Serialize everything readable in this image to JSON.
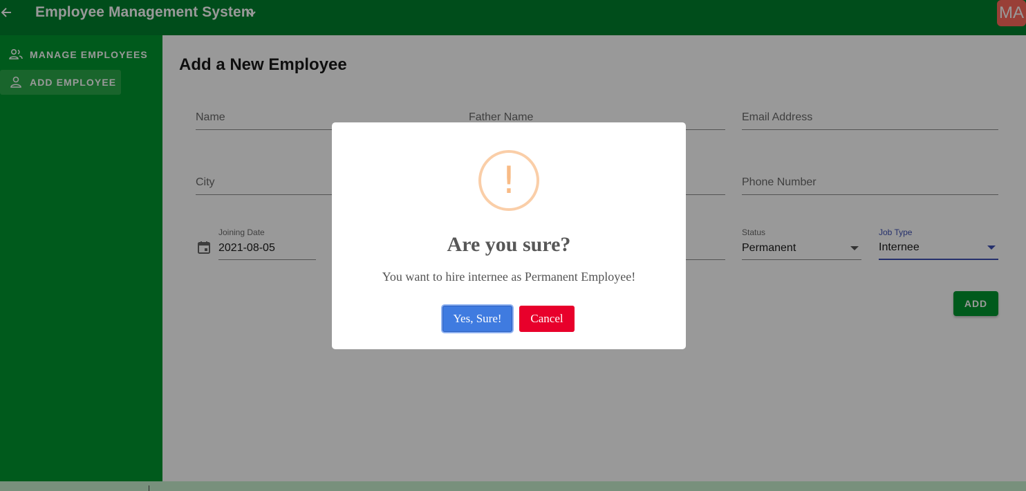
{
  "appbar": {
    "title": "Employee Management System",
    "avatar_initials": "MA",
    "back_icon": "arrow-left-icon",
    "menu_icon": "chevron-down-icon"
  },
  "sidebar": {
    "items": [
      {
        "label": "MANAGE EMPLOYEES",
        "icon": "people-icon",
        "active": false
      },
      {
        "label": "ADD EMPLOYEE",
        "icon": "person-icon",
        "active": true
      }
    ]
  },
  "form": {
    "heading": "Add a New Employee",
    "name_placeholder": "Name",
    "father_name_placeholder": "Father Name",
    "email_placeholder": "Email Address",
    "city_placeholder": "City",
    "phone_placeholder": "Phone Number",
    "joining_date_label": "Joining Date",
    "joining_date_value": "2021-08-05",
    "status_label": "Status",
    "status_value": "Permanent",
    "job_type_label": "Job Type",
    "job_type_value": "Internee",
    "add_label": "ADD"
  },
  "dialog": {
    "icon": "!",
    "title": "Are you sure?",
    "text": "You want to hire internee as Permanent Employee!",
    "confirm_label": "Yes, Sure!",
    "cancel_label": "Cancel"
  },
  "colors": {
    "appbar": "#00802d",
    "sidebar": "#00962f",
    "confirm": "#3f7be0",
    "cancel": "#e8002b",
    "warning": "#f8bb86",
    "focus": "#3f51b5"
  }
}
